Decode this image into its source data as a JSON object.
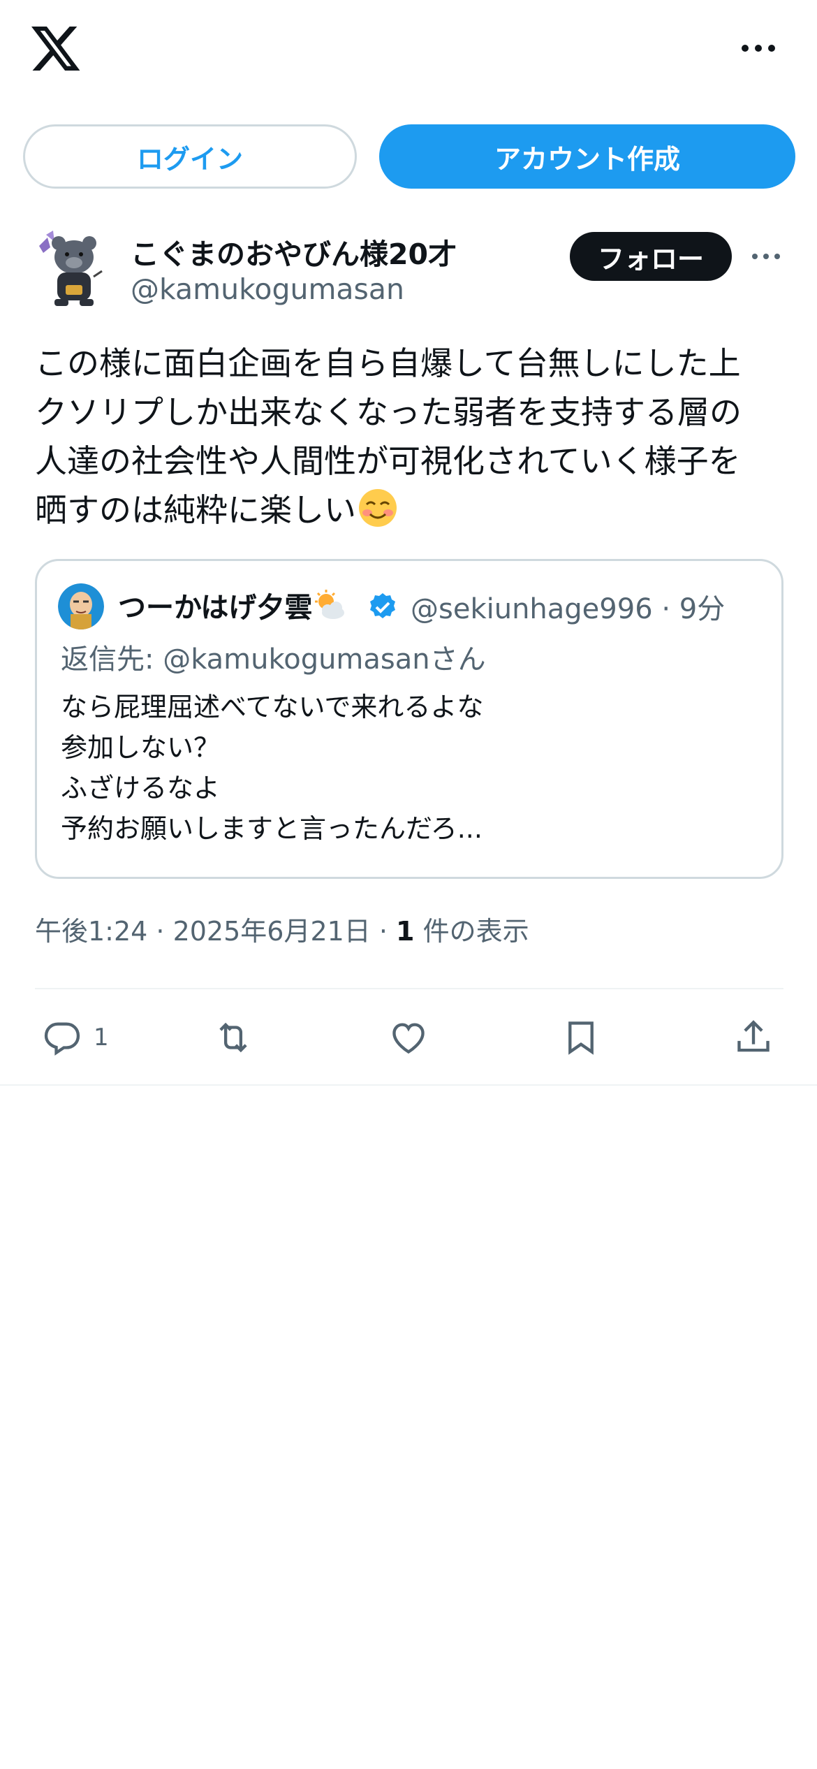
{
  "header": {
    "logo_icon": "x-logo-icon",
    "more_icon": "more-horizontal-icon"
  },
  "auth": {
    "login_label": "ログイン",
    "signup_label": "アカウント作成"
  },
  "author": {
    "name": "こぐまのおやびん様20才",
    "handle": "@kamukogumasan",
    "follow_label": "フォロー"
  },
  "tweet": {
    "text": "この様に面白企画を自ら自爆して台無しにした上\nクソリプしか出来なくなった弱者を支持する層の\n人達の社会性や人間性が可視化されていく様子を\n晒すのは純粋に楽しい",
    "emoji": "smiling-face-icon"
  },
  "quote": {
    "name": "つーかはげ夕雲",
    "name_emoji": "sun-behind-cloud-icon",
    "badge": "verified-badge-icon",
    "handle_time": "@sekiunhage996 · 9分",
    "reply_to": "返信先: @kamukogumasanさん",
    "body": "なら屁理屈述べてないで来れるよな\n参加しない？\nふざけるなよ\n予約お願いしますと言ったんだろ..."
  },
  "meta": {
    "datetime": "午後1:24 · 2025年6月21日 · ",
    "views_count": "1",
    "views_label": " 件の表示"
  },
  "actions": {
    "reply_count": "1",
    "reply_icon": "reply-icon",
    "retweet_icon": "retweet-icon",
    "like_icon": "heart-icon",
    "bookmark_icon": "bookmark-icon",
    "share_icon": "share-icon"
  },
  "colors": {
    "accent": "#1d9bf0",
    "text_primary": "#0f1419",
    "text_secondary": "#536471",
    "border": "#cfd9de"
  }
}
